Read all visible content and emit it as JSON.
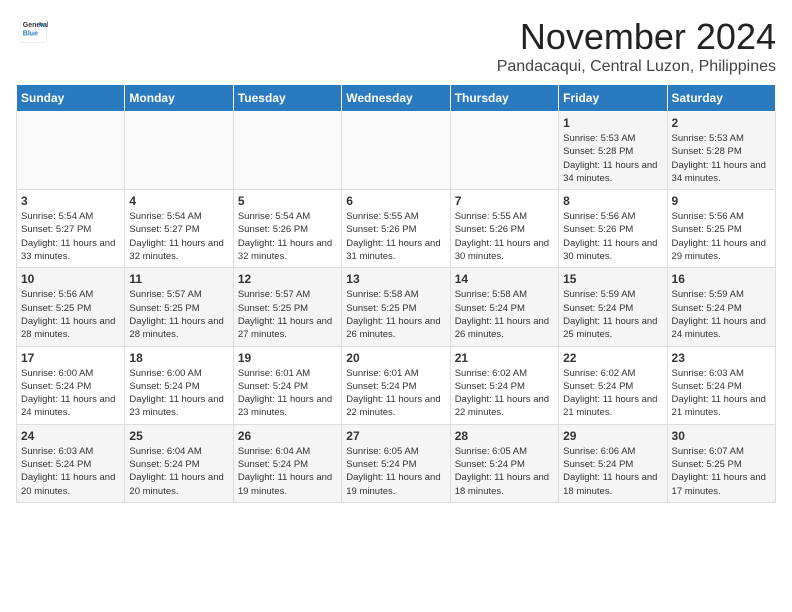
{
  "header": {
    "logo_line1": "General",
    "logo_line2": "Blue",
    "month": "November 2024",
    "location": "Pandacaqui, Central Luzon, Philippines"
  },
  "weekdays": [
    "Sunday",
    "Monday",
    "Tuesday",
    "Wednesday",
    "Thursday",
    "Friday",
    "Saturday"
  ],
  "weeks": [
    [
      {
        "day": "",
        "info": ""
      },
      {
        "day": "",
        "info": ""
      },
      {
        "day": "",
        "info": ""
      },
      {
        "day": "",
        "info": ""
      },
      {
        "day": "",
        "info": ""
      },
      {
        "day": "1",
        "info": "Sunrise: 5:53 AM\nSunset: 5:28 PM\nDaylight: 11 hours\nand 34 minutes."
      },
      {
        "day": "2",
        "info": "Sunrise: 5:53 AM\nSunset: 5:28 PM\nDaylight: 11 hours\nand 34 minutes."
      }
    ],
    [
      {
        "day": "3",
        "info": "Sunrise: 5:54 AM\nSunset: 5:27 PM\nDaylight: 11 hours\nand 33 minutes."
      },
      {
        "day": "4",
        "info": "Sunrise: 5:54 AM\nSunset: 5:27 PM\nDaylight: 11 hours\nand 32 minutes."
      },
      {
        "day": "5",
        "info": "Sunrise: 5:54 AM\nSunset: 5:26 PM\nDaylight: 11 hours\nand 32 minutes."
      },
      {
        "day": "6",
        "info": "Sunrise: 5:55 AM\nSunset: 5:26 PM\nDaylight: 11 hours\nand 31 minutes."
      },
      {
        "day": "7",
        "info": "Sunrise: 5:55 AM\nSunset: 5:26 PM\nDaylight: 11 hours\nand 30 minutes."
      },
      {
        "day": "8",
        "info": "Sunrise: 5:56 AM\nSunset: 5:26 PM\nDaylight: 11 hours\nand 30 minutes."
      },
      {
        "day": "9",
        "info": "Sunrise: 5:56 AM\nSunset: 5:25 PM\nDaylight: 11 hours\nand 29 minutes."
      }
    ],
    [
      {
        "day": "10",
        "info": "Sunrise: 5:56 AM\nSunset: 5:25 PM\nDaylight: 11 hours\nand 28 minutes."
      },
      {
        "day": "11",
        "info": "Sunrise: 5:57 AM\nSunset: 5:25 PM\nDaylight: 11 hours\nand 28 minutes."
      },
      {
        "day": "12",
        "info": "Sunrise: 5:57 AM\nSunset: 5:25 PM\nDaylight: 11 hours\nand 27 minutes."
      },
      {
        "day": "13",
        "info": "Sunrise: 5:58 AM\nSunset: 5:25 PM\nDaylight: 11 hours\nand 26 minutes."
      },
      {
        "day": "14",
        "info": "Sunrise: 5:58 AM\nSunset: 5:24 PM\nDaylight: 11 hours\nand 26 minutes."
      },
      {
        "day": "15",
        "info": "Sunrise: 5:59 AM\nSunset: 5:24 PM\nDaylight: 11 hours\nand 25 minutes."
      },
      {
        "day": "16",
        "info": "Sunrise: 5:59 AM\nSunset: 5:24 PM\nDaylight: 11 hours\nand 24 minutes."
      }
    ],
    [
      {
        "day": "17",
        "info": "Sunrise: 6:00 AM\nSunset: 5:24 PM\nDaylight: 11 hours\nand 24 minutes."
      },
      {
        "day": "18",
        "info": "Sunrise: 6:00 AM\nSunset: 5:24 PM\nDaylight: 11 hours\nand 23 minutes."
      },
      {
        "day": "19",
        "info": "Sunrise: 6:01 AM\nSunset: 5:24 PM\nDaylight: 11 hours\nand 23 minutes."
      },
      {
        "day": "20",
        "info": "Sunrise: 6:01 AM\nSunset: 5:24 PM\nDaylight: 11 hours\nand 22 minutes."
      },
      {
        "day": "21",
        "info": "Sunrise: 6:02 AM\nSunset: 5:24 PM\nDaylight: 11 hours\nand 22 minutes."
      },
      {
        "day": "22",
        "info": "Sunrise: 6:02 AM\nSunset: 5:24 PM\nDaylight: 11 hours\nand 21 minutes."
      },
      {
        "day": "23",
        "info": "Sunrise: 6:03 AM\nSunset: 5:24 PM\nDaylight: 11 hours\nand 21 minutes."
      }
    ],
    [
      {
        "day": "24",
        "info": "Sunrise: 6:03 AM\nSunset: 5:24 PM\nDaylight: 11 hours\nand 20 minutes."
      },
      {
        "day": "25",
        "info": "Sunrise: 6:04 AM\nSunset: 5:24 PM\nDaylight: 11 hours\nand 20 minutes."
      },
      {
        "day": "26",
        "info": "Sunrise: 6:04 AM\nSunset: 5:24 PM\nDaylight: 11 hours\nand 19 minutes."
      },
      {
        "day": "27",
        "info": "Sunrise: 6:05 AM\nSunset: 5:24 PM\nDaylight: 11 hours\nand 19 minutes."
      },
      {
        "day": "28",
        "info": "Sunrise: 6:05 AM\nSunset: 5:24 PM\nDaylight: 11 hours\nand 18 minutes."
      },
      {
        "day": "29",
        "info": "Sunrise: 6:06 AM\nSunset: 5:24 PM\nDaylight: 11 hours\nand 18 minutes."
      },
      {
        "day": "30",
        "info": "Sunrise: 6:07 AM\nSunset: 5:25 PM\nDaylight: 11 hours\nand 17 minutes."
      }
    ]
  ]
}
